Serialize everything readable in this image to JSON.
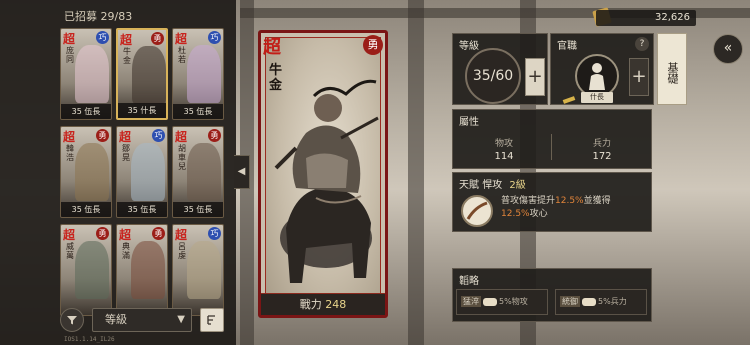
{
  "recruit_label": "已招募",
  "recruit_count": "29/83",
  "resource": {
    "icon": "jade-coin-icon",
    "amount": "32,626"
  },
  "roster": {
    "cards": [
      {
        "name": "庞同",
        "rank": "35 伍長",
        "badge": "巧",
        "badge_color": "#2e4fb0",
        "selected": false
      },
      {
        "name": "牛金",
        "rank": "35 什長",
        "badge": "勇",
        "badge_color": "#9b1e18",
        "selected": true
      },
      {
        "name": "杜若",
        "rank": "35 伍長",
        "badge": "巧",
        "badge_color": "#2e4fb0",
        "selected": false
      },
      {
        "name": "韓浩",
        "rank": "35 伍長",
        "badge": "勇",
        "badge_color": "#9b1e18",
        "selected": false
      },
      {
        "name": "鄒晃",
        "rank": "35 伍長",
        "badge": "巧",
        "badge_color": "#2e4fb0",
        "selected": false
      },
      {
        "name": "胡車兒",
        "rank": "35 伍長",
        "badge": "勇",
        "badge_color": "#9b1e18",
        "selected": false
      },
      {
        "name": "威萬",
        "rank": "",
        "badge": "勇",
        "badge_color": "#9b1e18",
        "selected": false
      },
      {
        "name": "典滿",
        "rank": "",
        "badge": "勇",
        "badge_color": "#9b1e18",
        "selected": false
      },
      {
        "name": "呂虔",
        "rank": "",
        "badge": "巧",
        "badge_color": "#2e4fb0",
        "selected": false
      }
    ],
    "sort_label": "等級",
    "build_text": "IOS1.1.14_IL26"
  },
  "hero": {
    "grade": "超",
    "trait": "勇",
    "name": "牛金",
    "power_label": "戰力",
    "power_value": "248"
  },
  "level_panel": {
    "title": "等級",
    "value": "35/60",
    "plus": "+"
  },
  "office_panel": {
    "title": "官職",
    "help": "?",
    "rank": "什長",
    "plus": "+"
  },
  "foundation_label": "基礎",
  "attributes": {
    "title": "屬性",
    "items": [
      {
        "label": "物攻",
        "value": "114"
      },
      {
        "label": "兵力",
        "value": "172"
      }
    ]
  },
  "talent": {
    "label": "天賦",
    "name": "悍攻",
    "level": "2級",
    "desc_a": "普攻傷害提升",
    "pct1": "12.5%",
    "desc_b": "並獲得",
    "pct2": "12.5%",
    "desc_c": "攻心"
  },
  "tactics": {
    "title": "韜略",
    "items": [
      {
        "name": "猛淬",
        "pct": "5%",
        "stat": "物攻"
      },
      {
        "name": "統御",
        "pct": "5%",
        "stat": "兵力"
      }
    ]
  },
  "colors": {
    "accent_red": "#9b1e18",
    "gold": "#e8d48b",
    "highlight": "#e0843a"
  }
}
